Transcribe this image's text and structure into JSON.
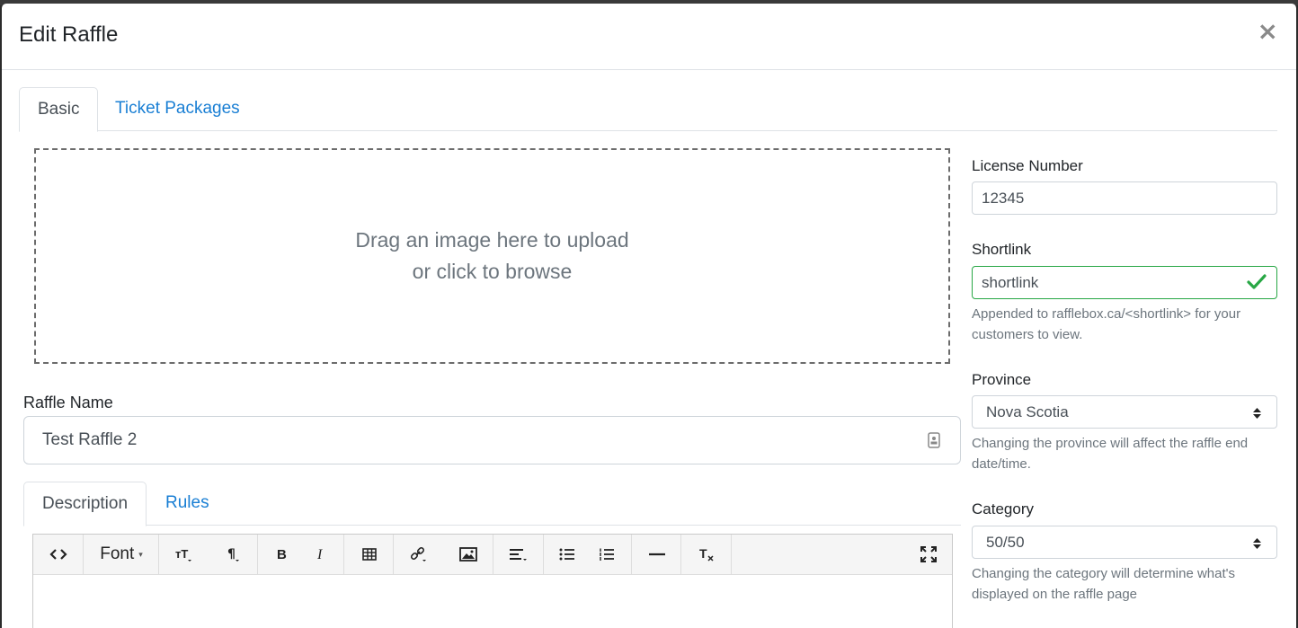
{
  "modal": {
    "title": "Edit Raffle",
    "close_label": "×"
  },
  "tabs": [
    {
      "label": "Basic",
      "active": true
    },
    {
      "label": "Ticket Packages",
      "active": false
    }
  ],
  "dropzone": {
    "line1": "Drag an image here to upload",
    "line2": "or click to browse"
  },
  "raffle_name": {
    "label": "Raffle Name",
    "value": "Test Raffle 2"
  },
  "license": {
    "label": "License Number",
    "value": "12345"
  },
  "shortlink": {
    "label": "Shortlink",
    "value": "shortlink",
    "help": "Appended to rafflebox.ca/<shortlink> for your customers to view."
  },
  "province": {
    "label": "Province",
    "value": "Nova Scotia",
    "help": "Changing the province will affect the raffle end date/time."
  },
  "category": {
    "label": "Category",
    "value": "50/50",
    "help": "Changing the category will determine what's displayed on the raffle page"
  },
  "desc_tabs": [
    {
      "label": "Description",
      "active": true
    },
    {
      "label": "Rules",
      "active": false
    }
  ],
  "editor": {
    "font_label": "Font"
  },
  "colors": {
    "link": "#1a7fd4",
    "valid": "#28a745",
    "muted": "#6c757d"
  }
}
